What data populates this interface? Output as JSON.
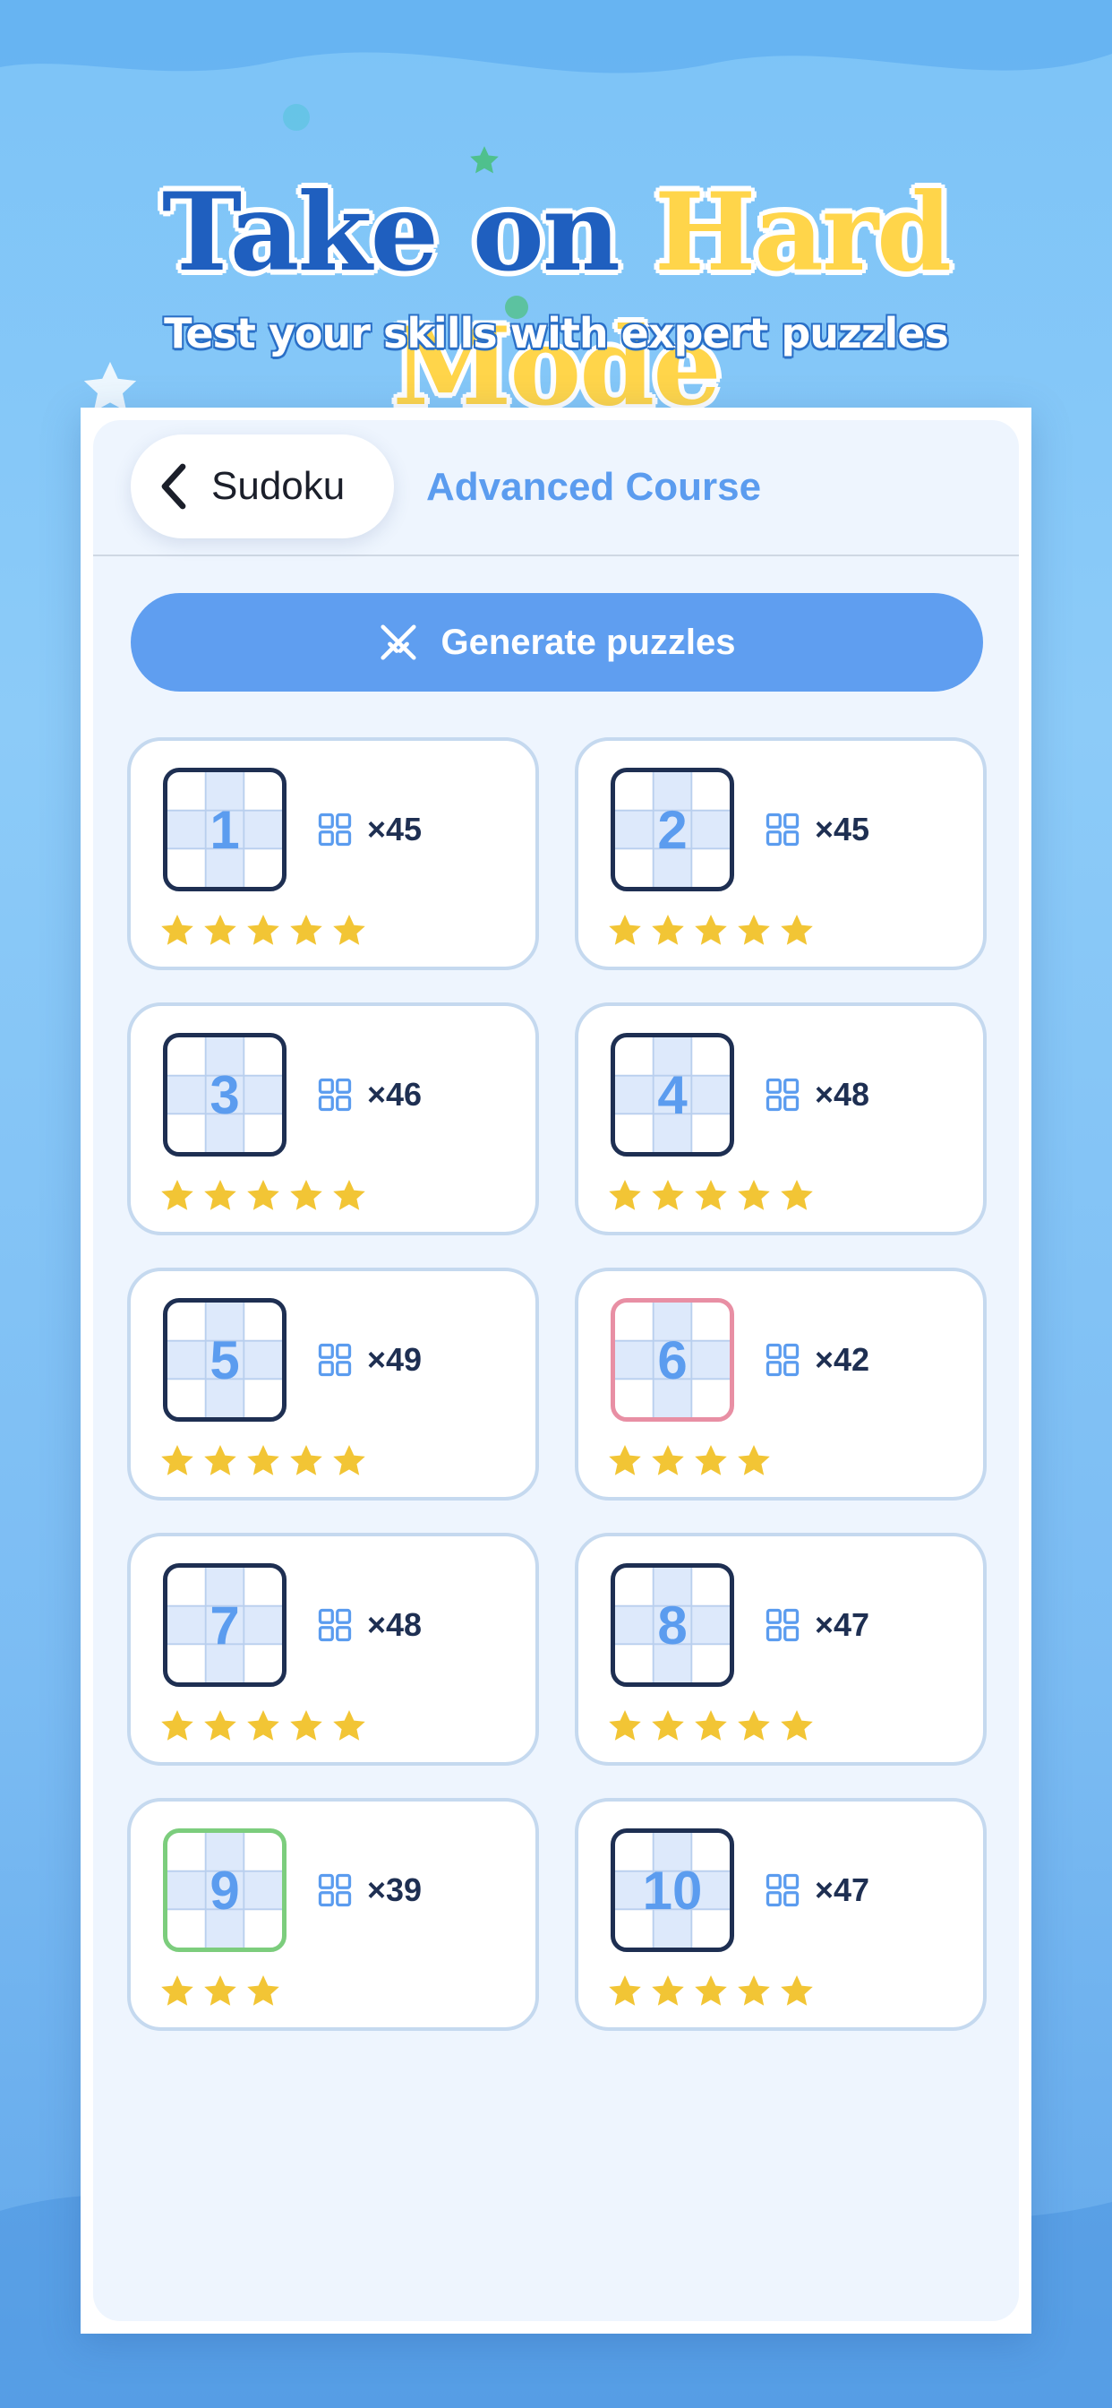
{
  "headline": {
    "part1": "Take on",
    "part2": "Hard Mode"
  },
  "subtitle": "Test your skills with expert puzzles",
  "topbar": {
    "back_label": "Sudoku",
    "title": "Advanced Course"
  },
  "generate_button": {
    "label": "Generate puzzles",
    "icon": "generate-icon"
  },
  "colors": {
    "accent": "#5f9ef0",
    "title_blue": "#1f5fbf",
    "title_yellow": "#ffd54a",
    "star": "#f2c535",
    "thumb_dark": "#1e2f52",
    "thumb_red": "#e88fa4",
    "thumb_green": "#7ccd7d"
  },
  "puzzles": [
    {
      "number": "1",
      "count": "×45",
      "stars": 5,
      "border": "dark"
    },
    {
      "number": "2",
      "count": "×45",
      "stars": 5,
      "border": "dark"
    },
    {
      "number": "3",
      "count": "×46",
      "stars": 5,
      "border": "dark"
    },
    {
      "number": "4",
      "count": "×48",
      "stars": 5,
      "border": "dark"
    },
    {
      "number": "5",
      "count": "×49",
      "stars": 5,
      "border": "dark"
    },
    {
      "number": "6",
      "count": "×42",
      "stars": 4,
      "border": "red"
    },
    {
      "number": "7",
      "count": "×48",
      "stars": 5,
      "border": "dark"
    },
    {
      "number": "8",
      "count": "×47",
      "stars": 5,
      "border": "dark"
    },
    {
      "number": "9",
      "count": "×39",
      "stars": 3,
      "border": "green"
    },
    {
      "number": "10",
      "count": "×47",
      "stars": 5,
      "border": "dark"
    }
  ]
}
